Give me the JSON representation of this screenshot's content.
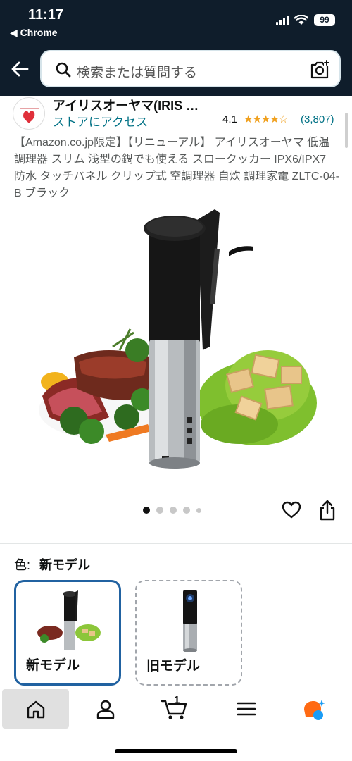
{
  "status_bar": {
    "time": "11:17",
    "back_app": "◀ Chrome",
    "battery": "99"
  },
  "search": {
    "placeholder": "検索または質問する"
  },
  "brand": {
    "name": "アイリスオーヤマ(IRIS …",
    "store_link": "ストアにアクセス",
    "rating": "4.1",
    "stars": "★★★★☆",
    "rating_count": "(3,807)",
    "rating_value": 4.1
  },
  "product": {
    "title": "【Amazon.co.jp限定】【リニューアル】 アイリスオーヤマ 低温調理器 スリム 浅型の鍋でも使える スロークッカー IPX6/IPX7 防水 タッチパネル クリップ式 空調理器 自炊 調理家電 ZLTC-04-B ブラック",
    "image_count": 5,
    "active_image": 1
  },
  "color": {
    "label": "色:",
    "selected": "新モデル"
  },
  "variants": [
    {
      "label": "新モデル",
      "selected": true
    },
    {
      "label": "旧モデル",
      "selected": false
    }
  ],
  "nav": {
    "items": [
      "home-icon",
      "account-icon",
      "cart-icon",
      "menu-icon",
      "rufus-icon"
    ],
    "cart_count": "1"
  },
  "colors": {
    "header_bg": "#0f1d2b",
    "link": "#007185",
    "star": "#f0a01e",
    "selected_border": "#2162a1",
    "rufus_orange": "#ff6a13",
    "rufus_blue": "#1b9cf5"
  }
}
